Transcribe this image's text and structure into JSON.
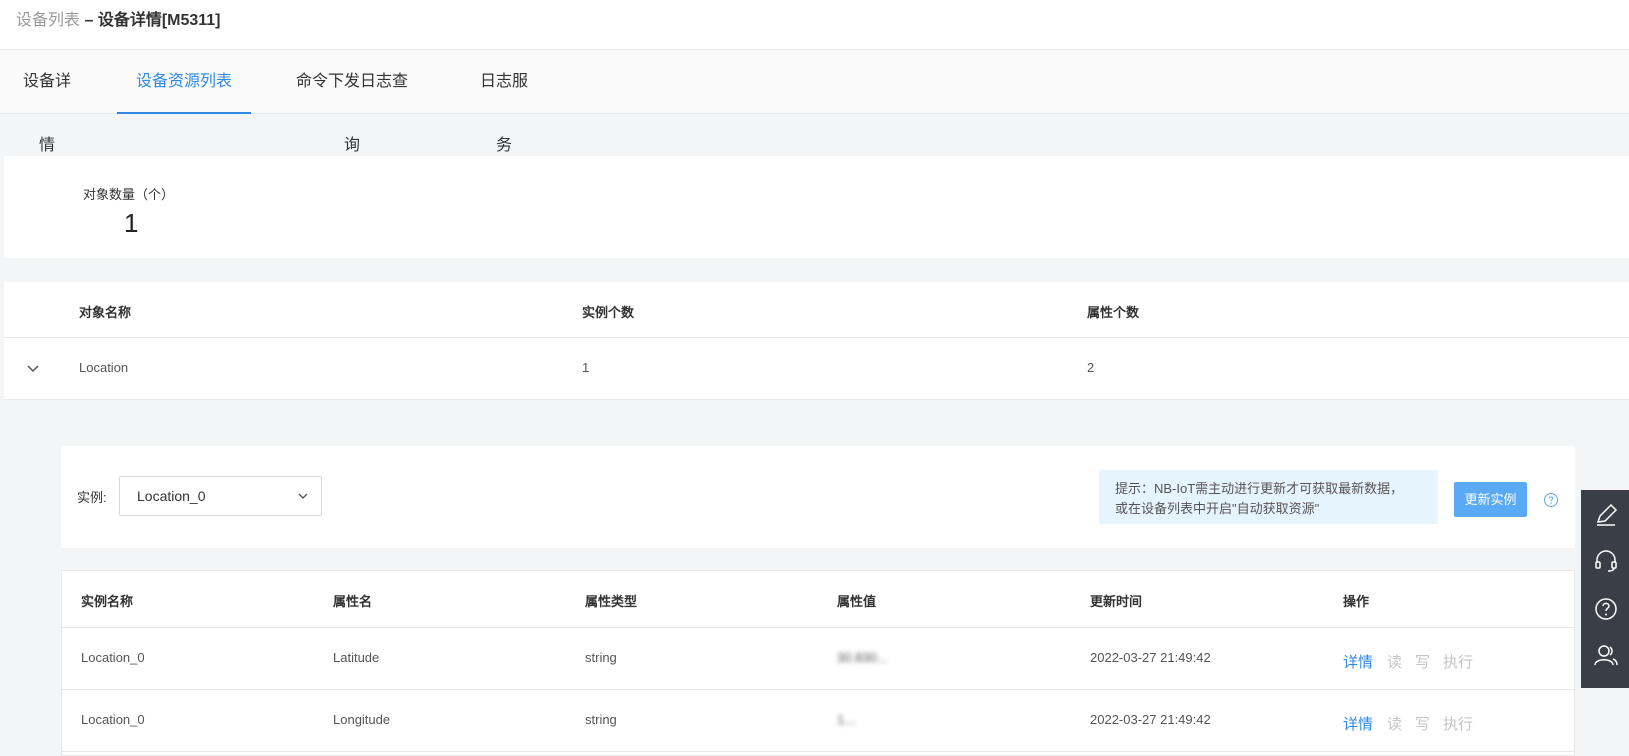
{
  "breadcrumb": {
    "parent": "设备列表",
    "separator": " – ",
    "current": "设备详情[M5311]"
  },
  "tabs": [
    {
      "label": "设备详情",
      "active": false
    },
    {
      "label": "设备资源列表",
      "active": true
    },
    {
      "label": "命令下发日志查询",
      "active": false
    },
    {
      "label": "日志服务",
      "active": false
    }
  ],
  "object_count": {
    "label": "对象数量（个）",
    "value": "1"
  },
  "object_table": {
    "columns": [
      "对象名称",
      "实例个数",
      "属性个数"
    ],
    "rows": [
      {
        "name": "Location",
        "instances": "1",
        "attributes": "2",
        "expanded": true
      }
    ]
  },
  "instance_panel": {
    "label": "实例:",
    "selected": "Location_0",
    "tip_line1": "提示：NB-IoT需主动进行更新才可获取最新数据，",
    "tip_line2": "或在设备列表中开启\"自动获取资源\"",
    "update_button": "更新实例"
  },
  "attr_table": {
    "columns": [
      "实例名称",
      "属性名",
      "属性类型",
      "属性值",
      "更新时间",
      "操作"
    ],
    "rows": [
      {
        "instance": "Location_0",
        "attr": "Latitude",
        "type": "string",
        "value": "30.830...",
        "updated": "2022-03-27 21:49:42"
      },
      {
        "instance": "Location_0",
        "attr": "Longitude",
        "type": "string",
        "value": "1...",
        "updated": "2022-03-27 21:49:42"
      }
    ],
    "actions": {
      "detail": "详情",
      "read": "读",
      "write": "写",
      "execute": "执行"
    }
  },
  "colors": {
    "accent": "#2e8ae6",
    "button": "#5aa9f5",
    "tip_bg": "#e6f4fd",
    "floatbar": "#3a3e47"
  },
  "floatbar_icons": [
    "edit-icon",
    "headset-icon",
    "help-icon",
    "users-icon"
  ]
}
